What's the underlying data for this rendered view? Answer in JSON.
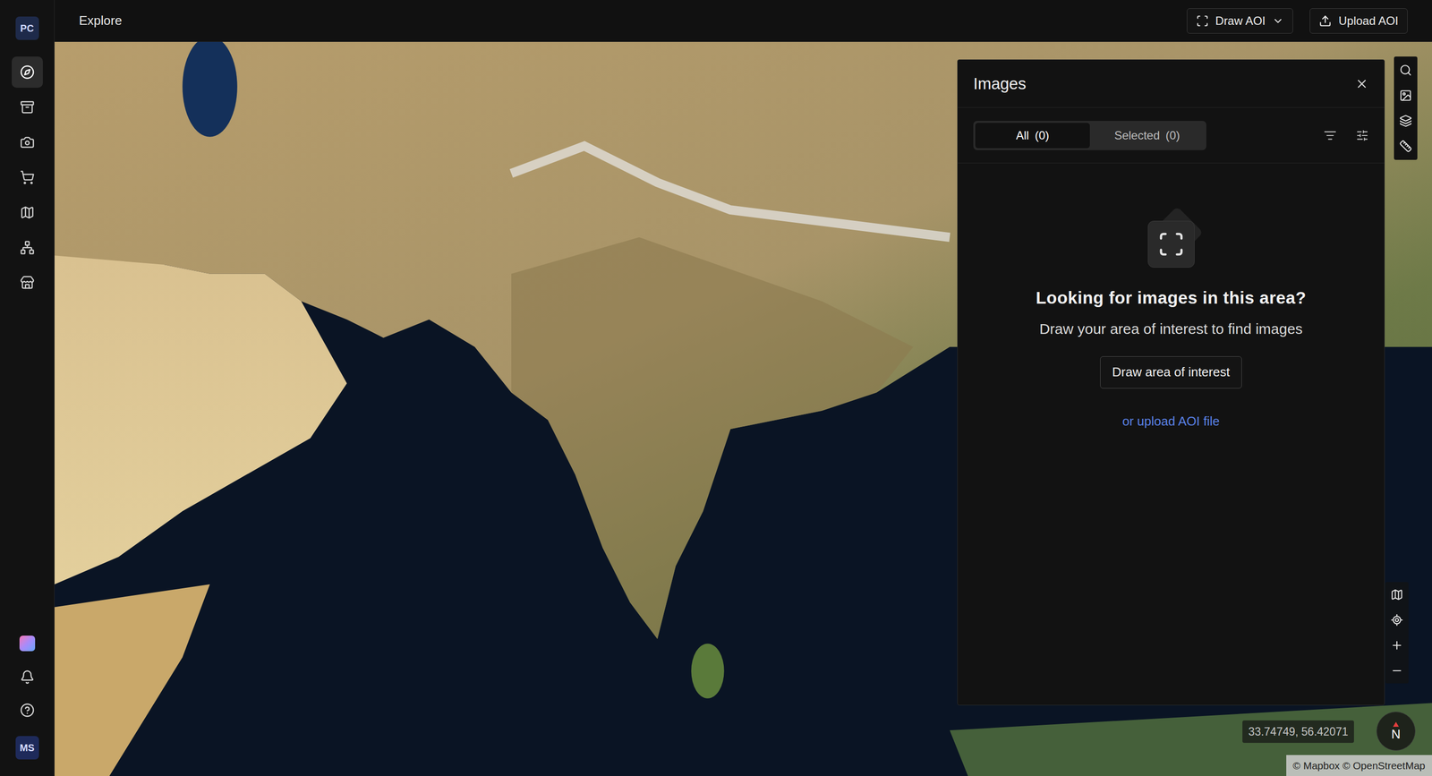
{
  "top_bar": {
    "title": "Explore",
    "buttons": [
      {
        "label": "Draw AOI",
        "kind": "dropdown"
      },
      {
        "label": "Upload AOI",
        "kind": "upload"
      }
    ]
  },
  "sidebar": {
    "logo": "PC",
    "items": [
      {
        "selected": true
      },
      {
        "selected": false
      },
      {
        "selected": false
      },
      {
        "selected": false
      },
      {
        "selected": false
      },
      {
        "selected": false
      },
      {
        "selected": false
      }
    ],
    "avatar": "MS"
  },
  "images_panel": {
    "title": "Images",
    "tabs": [
      {
        "label": "All",
        "count": "(0)",
        "selected": true
      },
      {
        "label": "Selected",
        "count": "(0)",
        "selected": false
      }
    ],
    "empty_state": {
      "heading": "Looking for images in this area?",
      "text": "Draw your area of interest to find images",
      "button": "Draw area of interest",
      "link": "or upload AOI file"
    }
  },
  "map": {
    "coordinates": "33.74749, 56.42071",
    "attribution": "© Mapbox © OpenStreetMap",
    "compass": "N"
  }
}
